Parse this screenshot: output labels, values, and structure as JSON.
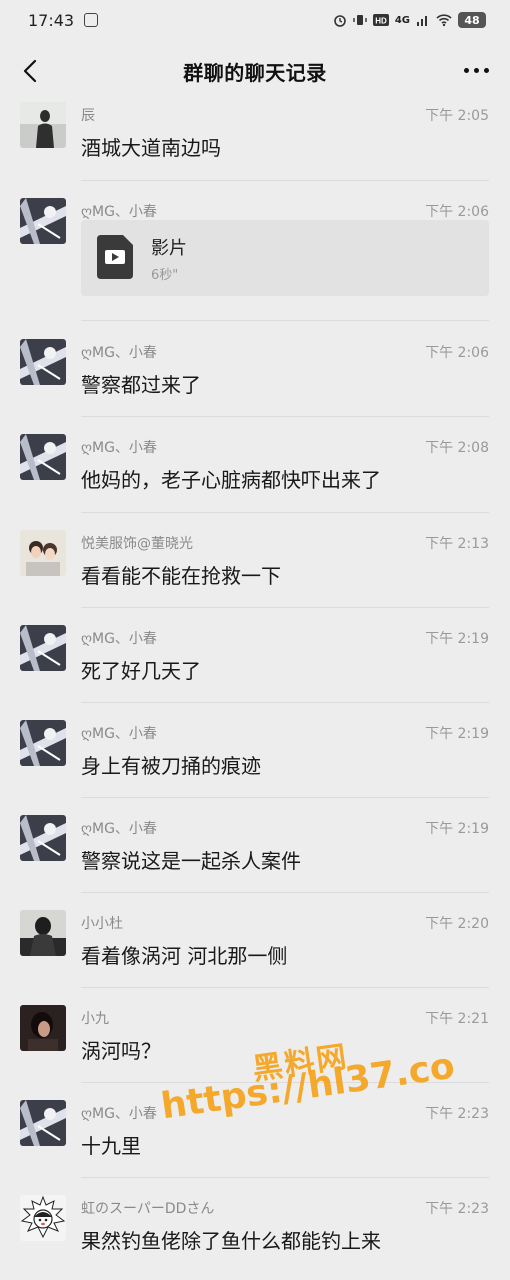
{
  "status_bar": {
    "time": "17:43",
    "battery": "48",
    "network": "4G"
  },
  "header": {
    "title": "群聊的聊天记录"
  },
  "messages": [
    {
      "sender": "辰",
      "time": "下午 2:05",
      "text": "酒城大道南边吗"
    },
    {
      "sender": "ღMG、小春",
      "time": "下午 2:06",
      "file": {
        "name": "影片",
        "meta": "6秒\""
      }
    },
    {
      "sender": "ღMG、小春",
      "time": "下午 2:06",
      "text": "警察都过来了"
    },
    {
      "sender": "ღMG、小春",
      "time": "下午 2:08",
      "text": "他妈的，老子心脏病都快吓出来了"
    },
    {
      "sender": "悦美服饰@董晓光",
      "time": "下午 2:13",
      "text": "看看能不能在抢救一下"
    },
    {
      "sender": "ღMG、小春",
      "time": "下午 2:19",
      "text": "死了好几天了"
    },
    {
      "sender": "ღMG、小春",
      "time": "下午 2:19",
      "text": "身上有被刀捅的痕迹"
    },
    {
      "sender": "ღMG、小春",
      "time": "下午 2:19",
      "text": "警察说这是一起杀人案件"
    },
    {
      "sender": "小小杜",
      "time": "下午 2:20",
      "text": "看着像涡河 河北那一侧"
    },
    {
      "sender": "小九",
      "time": "下午 2:21",
      "text": "涡河吗？"
    },
    {
      "sender": "ღMG、小春",
      "time": "下午 2:23",
      "text": "十九里"
    },
    {
      "sender": "虹のスーパーDDさん",
      "time": "下午 2:23",
      "text": "果然钓鱼佬除了鱼什么都能钓上来"
    }
  ],
  "watermark": {
    "line1": "黑料网",
    "line2": "https://hl37.co"
  },
  "colors": {
    "background": "#ededed",
    "file_card": "#e2e2e2",
    "watermark": "#f5a623"
  }
}
